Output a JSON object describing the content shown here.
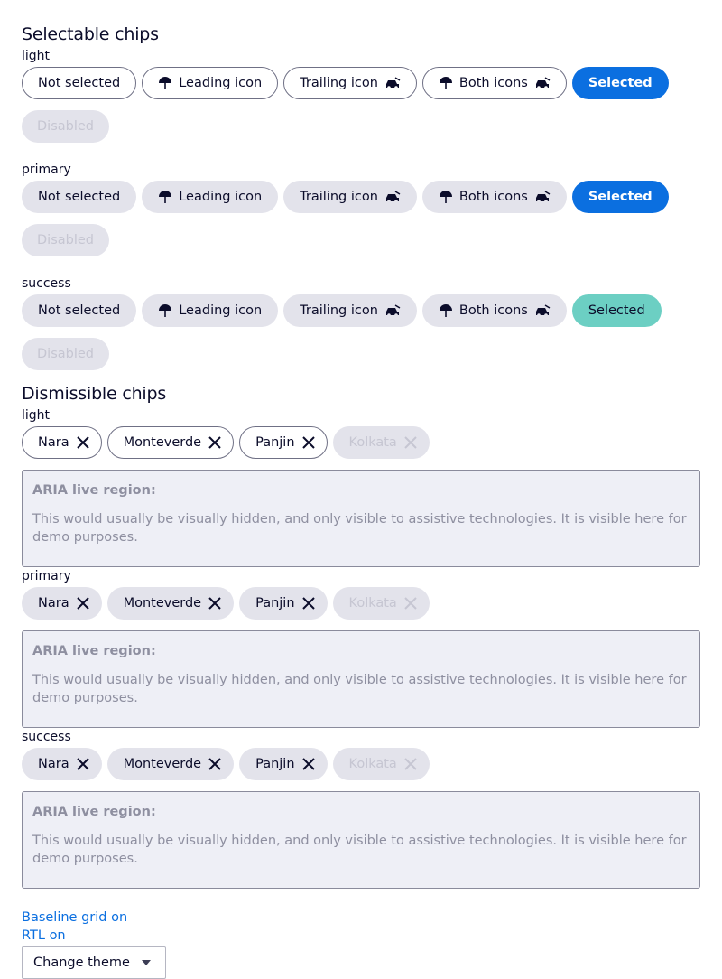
{
  "selectable": {
    "heading": "Selectable chips",
    "groups": [
      {
        "label": "light",
        "variant": "outline",
        "chips": [
          "Not selected",
          "Leading icon",
          "Trailing icon",
          "Both icons",
          "Selected",
          "Disabled"
        ]
      },
      {
        "label": "primary",
        "variant": "filled",
        "chips": [
          "Not selected",
          "Leading icon",
          "Trailing icon",
          "Both icons",
          "Selected",
          "Disabled"
        ]
      },
      {
        "label": "success",
        "variant": "filled",
        "chips": [
          "Not selected",
          "Leading icon",
          "Trailing icon",
          "Both icons",
          "Selected",
          "Disabled"
        ]
      }
    ],
    "icons": {
      "leading": "umbrella-icon",
      "trailing": "car-icon"
    }
  },
  "dismissible": {
    "heading": "Dismissible chips",
    "groups": [
      {
        "label": "light",
        "variant": "outline",
        "chips": [
          "Nara",
          "Monteverde",
          "Panjin",
          "Kolkata"
        ]
      },
      {
        "label": "primary",
        "variant": "filled",
        "chips": [
          "Nara",
          "Monteverde",
          "Panjin",
          "Kolkata"
        ]
      },
      {
        "label": "success",
        "variant": "filled",
        "chips": [
          "Nara",
          "Monteverde",
          "Panjin",
          "Kolkata"
        ]
      }
    ],
    "icons": {
      "dismiss": "close-icon"
    }
  },
  "live_region": {
    "title": "ARIA live region:",
    "text": "This would usually be visually hidden, and only visible to assistive technologies. It is visible here for demo purposes."
  },
  "footer": {
    "baseline_grid": "Baseline grid on",
    "rtl": "RTL on",
    "theme_select": "Change theme"
  },
  "colors": {
    "selected_blue": "#0b6fe0",
    "selected_green": "#6ccfc3",
    "chip_filled": "#e3e3eb",
    "text": "#0b0c2a"
  }
}
